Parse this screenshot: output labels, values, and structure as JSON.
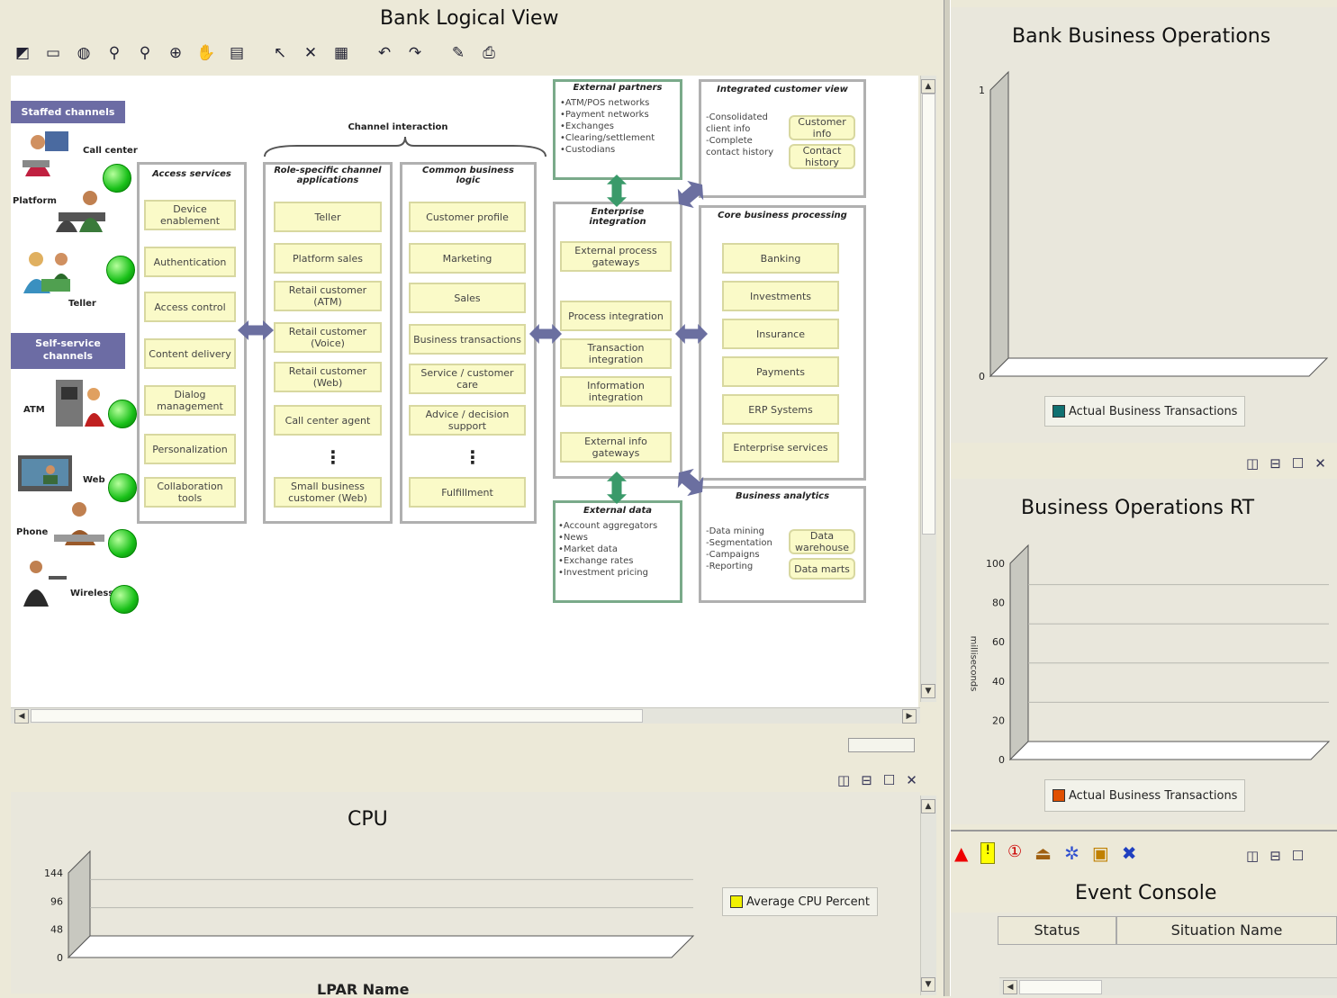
{
  "logical_view": {
    "title": "Bank Logical View",
    "toolbar_icons": [
      "select-view-icon",
      "fit-icon",
      "globe-icon",
      "zoom-in-icon",
      "zoom-out-icon",
      "zoom-fit-icon",
      "pan-hand-icon",
      "properties-icon",
      "pointer-icon",
      "delete-icon",
      "grid-icon",
      "undo-icon",
      "redo-icon",
      "edit-icon",
      "print-icon"
    ],
    "staffed_channels": "Staffed channels",
    "self_service": "Self-service channels",
    "channels": {
      "call_center": "Call center",
      "platform": "Platform",
      "teller": "Teller",
      "atm": "ATM",
      "web": "Web",
      "phone": "Phone",
      "wireless": "Wireless"
    },
    "channel_interaction": "Channel interaction",
    "access_services": {
      "title": "Access services",
      "items": [
        "Device enablement",
        "Authentication",
        "Access control",
        "Content delivery",
        "Dialog management",
        "Personalization",
        "Collaboration tools"
      ]
    },
    "role_specific": {
      "title": "Role-specific channel applications",
      "items": [
        "Teller",
        "Platform sales",
        "Retail customer (ATM)",
        "Retail customer (Voice)",
        "Retail customer (Web)",
        "Call center agent",
        "⋮",
        "Small business customer (Web)"
      ]
    },
    "common_logic": {
      "title": "Common business logic",
      "items": [
        "Customer profile",
        "Marketing",
        "Sales",
        "Business transactions",
        "Service / customer care",
        "Advice / decision support",
        "⋮",
        "Fulfillment"
      ]
    },
    "external_partners": {
      "title": "External partners",
      "lines": "•ATM/POS networks\n•Payment networks\n•Exchanges\n•Clearing/settlement\n•Custodians"
    },
    "integrated_view": {
      "title": "Integrated customer view",
      "lines": "-Consolidated\nclient info\n-Complete\ncontact history",
      "db1": "Customer info",
      "db2": "Contact history"
    },
    "enterprise_integration": {
      "title": "Enterprise integration",
      "items": [
        "External process gateways",
        "Process integration",
        "Transaction integration",
        "Information integration",
        "External info gateways"
      ]
    },
    "core_processing": {
      "title": "Core business processing",
      "items": [
        "Banking",
        "Investments",
        "Insurance",
        "Payments",
        "ERP Systems",
        "Enterprise services"
      ]
    },
    "external_data": {
      "title": "External data",
      "lines": "•Account aggregators\n•News\n•Market data\n•Exchange rates\n•Investment pricing"
    },
    "business_analytics": {
      "title": "Business analytics",
      "lines": "-Data mining\n-Segmentation\n-Campaigns\n-Reporting",
      "db1": "Data warehouse",
      "db2": "Data marts"
    }
  },
  "cpu": {
    "title": "CPU",
    "xlabel": "LPAR Name",
    "legend": "Average CPU Percent",
    "legend_color": "#f0f000",
    "ticks": [
      "144",
      "96",
      "48",
      "0"
    ]
  },
  "bank_ops": {
    "title": "Bank Business Operations",
    "legend": "Actual Business Transactions",
    "legend_color": "#107070",
    "ticks": [
      "1",
      "0"
    ]
  },
  "ops_rt": {
    "title": "Business Operations RT",
    "ylabel": "milliseconds",
    "legend": "Actual Business Transactions",
    "legend_color": "#e05000",
    "ticks": [
      "100",
      "80",
      "60",
      "40",
      "20",
      "0"
    ]
  },
  "events": {
    "title": "Event Console",
    "columns": [
      "Status",
      "Situation Name"
    ]
  },
  "chart_data": [
    {
      "type": "bar",
      "title": "CPU",
      "xlabel": "LPAR Name",
      "ylabel": "",
      "ylim": [
        0,
        144
      ],
      "series": [
        {
          "name": "Average CPU Percent",
          "values": []
        }
      ]
    },
    {
      "type": "bar",
      "title": "Bank Business Operations",
      "ylim": [
        0,
        1
      ],
      "series": [
        {
          "name": "Actual Business Transactions",
          "values": []
        }
      ]
    },
    {
      "type": "bar",
      "title": "Business Operations RT",
      "ylabel": "milliseconds",
      "ylim": [
        0,
        100
      ],
      "series": [
        {
          "name": "Actual Business Transactions",
          "values": []
        }
      ]
    }
  ]
}
